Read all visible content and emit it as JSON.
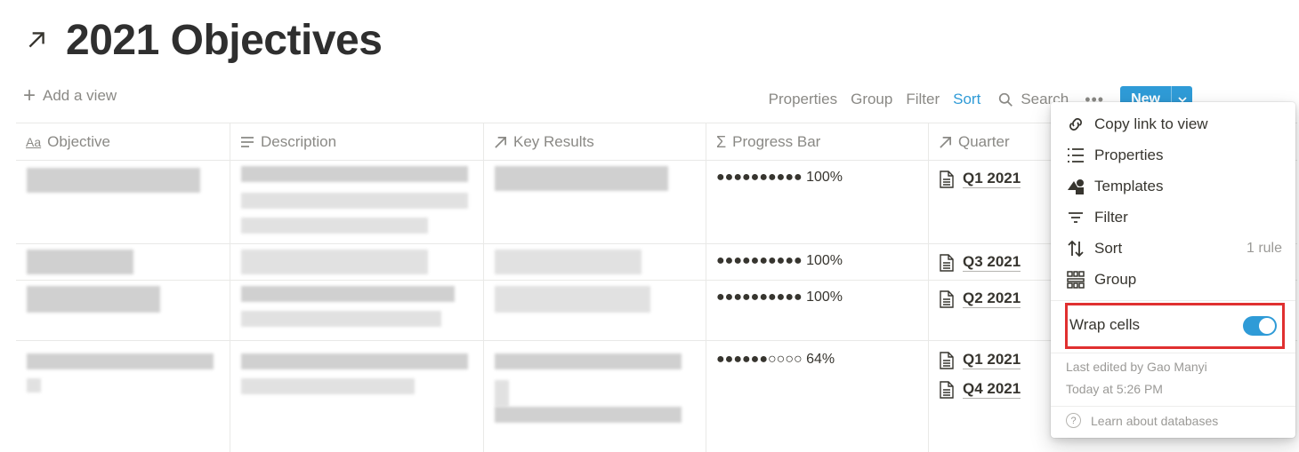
{
  "page": {
    "title": "2021 Objectives",
    "title_icon": "arrow-up-right-icon"
  },
  "toolbar": {
    "add_view": "Add a view",
    "properties": "Properties",
    "group": "Group",
    "filter": "Filter",
    "sort": "Sort",
    "search": "Search",
    "more": "•••",
    "new": "New",
    "accent_color": "#2f9bd7"
  },
  "table": {
    "columns": [
      {
        "label": "Objective",
        "icon": "text-icon"
      },
      {
        "label": "Description",
        "icon": "lines-icon"
      },
      {
        "label": "Key Results",
        "icon": "relation-arrow-icon"
      },
      {
        "label": "Progress Bar",
        "icon": "sigma-icon"
      },
      {
        "label": "Quarter",
        "icon": "relation-arrow-icon"
      }
    ],
    "rows": [
      {
        "progress": "●●●●●●●●●● 100%",
        "progress_value": 1.0,
        "quarters": [
          "Q1 2021"
        ]
      },
      {
        "progress": "●●●●●●●●●● 100%",
        "progress_value": 1.0,
        "quarters": [
          "Q3 2021"
        ]
      },
      {
        "progress": "●●●●●●●●●● 100%",
        "progress_value": 1.0,
        "quarters": [
          "Q2 2021"
        ]
      },
      {
        "progress": "●●●●●●○○○○ 64%",
        "progress_value": 0.64,
        "quarters": [
          "Q1 2021",
          "Q4 2021"
        ]
      }
    ]
  },
  "menu": {
    "items": [
      {
        "label": "Copy link to view",
        "icon": "link-icon"
      },
      {
        "label": "Properties",
        "icon": "list-icon"
      },
      {
        "label": "Templates",
        "icon": "templates-icon"
      },
      {
        "label": "Filter",
        "icon": "filter-icon"
      },
      {
        "label": "Sort",
        "icon": "sort-icon",
        "meta": "1 rule"
      },
      {
        "label": "Group",
        "icon": "group-icon"
      }
    ],
    "wrap_cells": {
      "label": "Wrap cells",
      "enabled": true,
      "highlight_color": "#e03030"
    },
    "last_edited": "Last edited by Gao Manyi",
    "edited_time": "Today at 5:26 PM",
    "learn": "Learn about databases"
  }
}
